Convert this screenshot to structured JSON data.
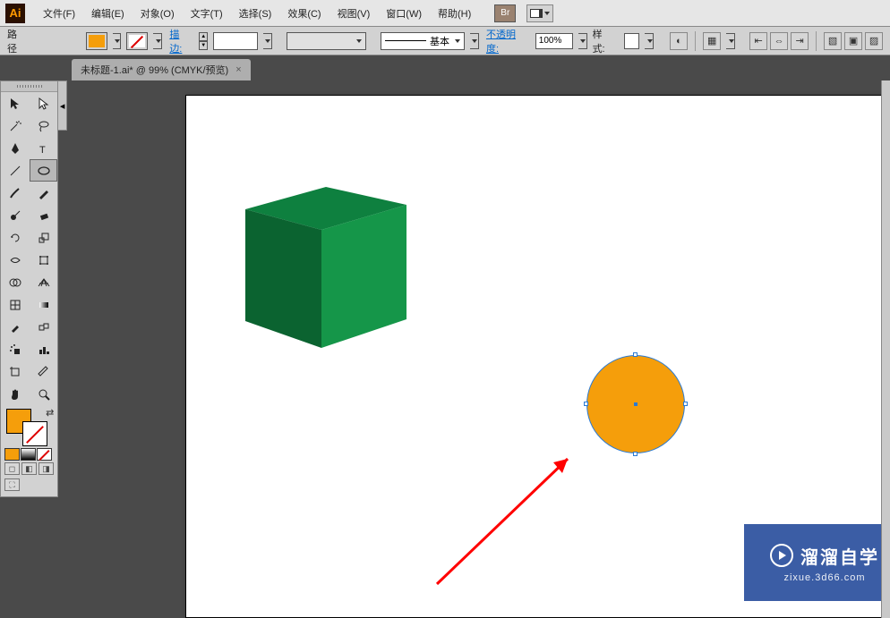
{
  "app": {
    "logo": "Ai"
  },
  "menu": {
    "file": "文件(F)",
    "edit": "编辑(E)",
    "object": "对象(O)",
    "type": "文字(T)",
    "select": "选择(S)",
    "effect": "效果(C)",
    "view": "视图(V)",
    "window": "窗口(W)",
    "help": "帮助(H)"
  },
  "bridge": {
    "label": "Br"
  },
  "options": {
    "selection_label": "路径",
    "fill_color": "#f59e0b",
    "stroke_label": "描边:",
    "stroke_weight": "",
    "brush_profile": "",
    "brush_label": "基本",
    "opacity_label": "不透明度:",
    "opacity_value": "100%",
    "style_label": "样式:"
  },
  "tab": {
    "title": "未标题-1.ai* @ 99% (CMYK/预览)",
    "close": "×"
  },
  "tools": {
    "selection": "selection",
    "direct": "direct-selection",
    "magicwand": "magic-wand",
    "lasso": "lasso",
    "pen": "pen",
    "type": "type",
    "line": "line",
    "ellipse": "ellipse",
    "brush": "paintbrush",
    "pencil": "pencil",
    "blob": "blob-brush",
    "eraser": "eraser",
    "rotate": "rotate",
    "scale": "scale",
    "width": "width",
    "free": "free-transform",
    "shapebuilder": "shape-builder",
    "perspective": "perspective-grid",
    "mesh": "mesh",
    "gradient": "gradient",
    "eyedrop": "eyedropper",
    "blend": "blend",
    "symbol": "symbol-sprayer",
    "graph": "column-graph",
    "artboard": "artboard",
    "slice": "slice",
    "hand": "hand",
    "zoom": "zoom"
  },
  "canvas": {
    "cube": {
      "top_fill": "#0e803f",
      "front_fill": "#159649",
      "side_fill": "#0b6330"
    },
    "circle": {
      "fill": "#f59e0b",
      "selected": true
    },
    "arrow": {
      "color": "#ff0000"
    }
  },
  "watermark": {
    "title": "溜溜自学",
    "sub": "zixue.3d66.com"
  }
}
